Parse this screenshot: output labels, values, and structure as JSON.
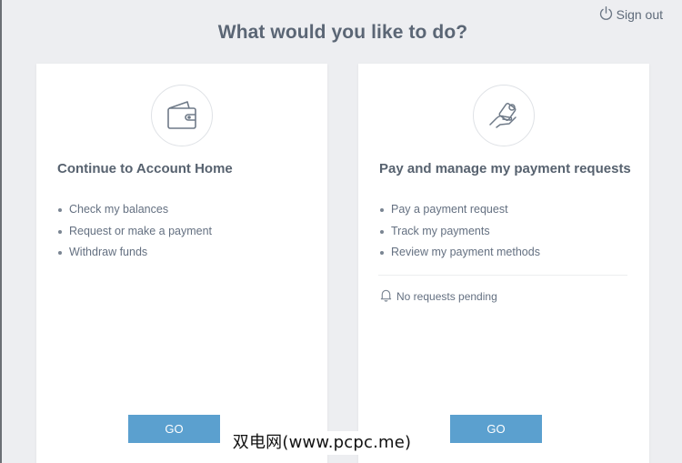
{
  "header": {
    "signout_label": "Sign out",
    "signout_icon": "power-icon",
    "title": "What would you like to do?"
  },
  "cards": [
    {
      "icon": "wallet-icon",
      "title": "Continue to Account Home",
      "items": [
        "Check my balances",
        "Request or make a payment",
        "Withdraw funds"
      ],
      "button_label": "GO"
    },
    {
      "icon": "hand-payment-icon",
      "title": "Pay and manage my payment requests",
      "items": [
        "Pay a payment request",
        "Track my payments",
        "Review my payment methods"
      ],
      "pending_icon": "bell-icon",
      "pending_text": "No requests pending",
      "button_label": "GO"
    }
  ],
  "watermark": "双电网(www.pcpc.me)",
  "colors": {
    "background": "#edeef1",
    "card": "#ffffff",
    "button": "#5ba0cf",
    "text": "#5f6b7a"
  }
}
